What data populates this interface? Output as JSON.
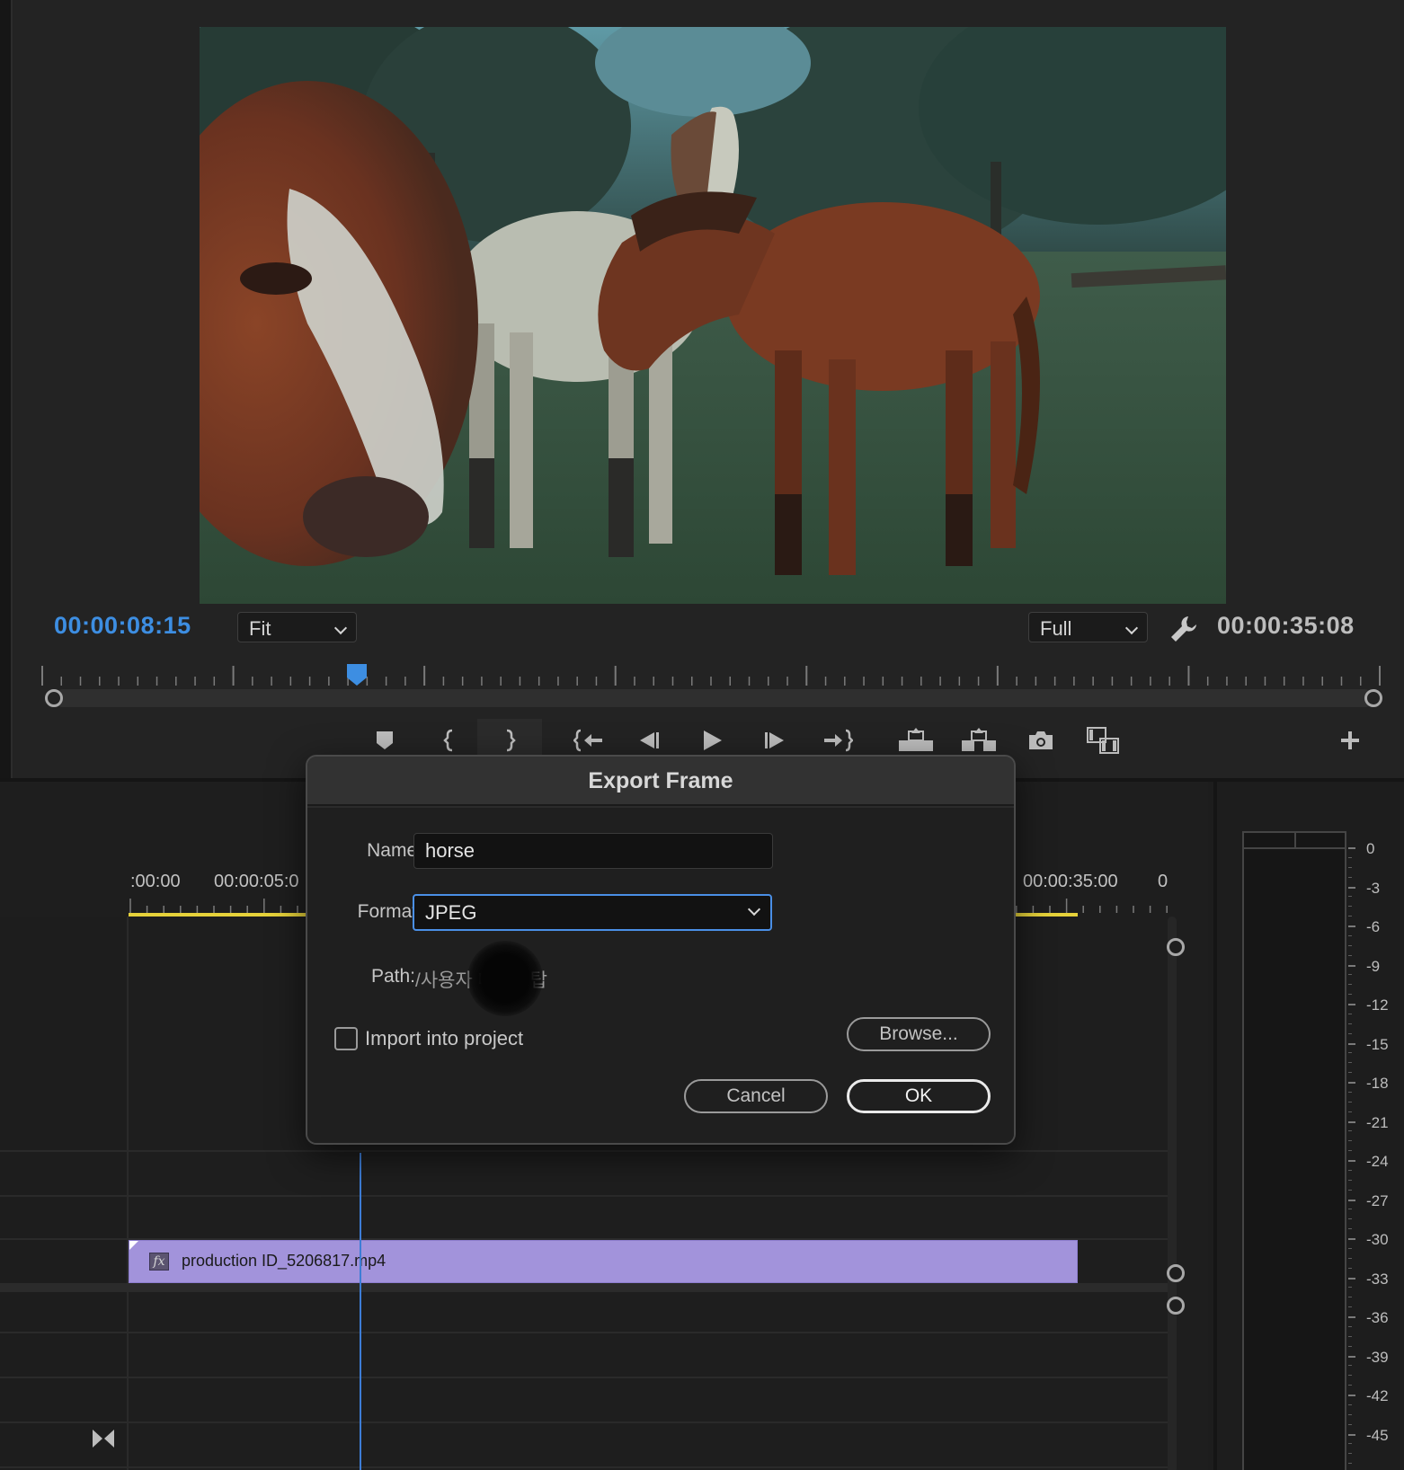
{
  "monitor": {
    "current_timecode": "00:00:08:15",
    "duration_timecode": "00:00:35:08",
    "zoom_value": "Fit",
    "quality_value": "Full",
    "playhead_fraction": 0.235
  },
  "transport": {
    "buttons": [
      {
        "name": "add-marker-button",
        "icon": "marker-icon"
      },
      {
        "name": "mark-in-button",
        "icon": "mark-in-icon"
      },
      {
        "name": "mark-out-button",
        "icon": "mark-out-icon",
        "active": true
      },
      {
        "name": "go-to-in-button",
        "icon": "go-to-in-icon"
      },
      {
        "name": "step-back-button",
        "icon": "step-back-icon"
      },
      {
        "name": "play-button",
        "icon": "play-icon"
      },
      {
        "name": "step-forward-button",
        "icon": "step-forward-icon"
      },
      {
        "name": "go-to-out-button",
        "icon": "go-to-out-icon"
      },
      {
        "name": "lift-button",
        "icon": "lift-icon"
      },
      {
        "name": "extract-button",
        "icon": "extract-icon"
      },
      {
        "name": "export-frame-button",
        "icon": "camera-icon"
      },
      {
        "name": "comparison-view-button",
        "icon": "comparison-icon"
      },
      {
        "name": "add-button",
        "icon": "plus-icon"
      }
    ]
  },
  "timeline": {
    "time_labels": [
      ":00:00",
      "00:00:05:0",
      "00:00:35:00",
      "0"
    ],
    "clip_name": "production ID_5206817.mp4",
    "clip_fx": "fx"
  },
  "meter": {
    "db_labels": [
      "0",
      "-3",
      "-6",
      "-9",
      "-12",
      "-15",
      "-18",
      "-21",
      "-24",
      "-27",
      "-30",
      "-33",
      "-36",
      "-39",
      "-42",
      "-45"
    ]
  },
  "dialog": {
    "title": "Export Frame",
    "name_label": "Name:",
    "name_value": "horse",
    "format_label": "Format:",
    "format_value": "JPEG",
    "path_label": "Path:",
    "path_value": "/사용자      데스크탑",
    "import_label": "Import into project",
    "import_checked": false,
    "browse_label": "Browse...",
    "cancel_label": "Cancel",
    "ok_label": "OK"
  },
  "colors": {
    "timecode_accent": "#3d8ee2",
    "clip_fill": "#a293db",
    "focus_ring": "#4a8fe6",
    "in_out_bar": "#e6d23a"
  }
}
